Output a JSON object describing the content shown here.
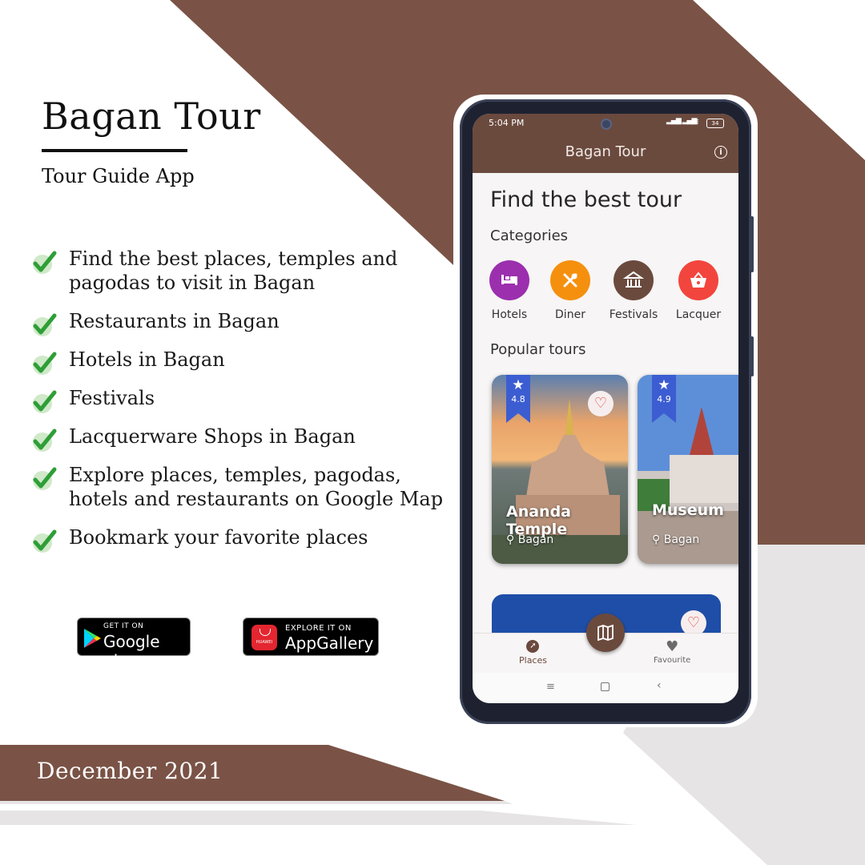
{
  "colors": {
    "brand_brown": "#7a5346",
    "light_gray": "#e6e4e5",
    "app_bar": "#6b4a3e"
  },
  "promo": {
    "title": "Bagan Tour",
    "subtitle": "Tour Guide  App",
    "features": [
      "Find the best places, temples and pagodas to visit in Bagan",
      "Restaurants in Bagan",
      "Hotels in Bagan",
      "Festivals",
      "Lacquerware Shops in Bagan",
      "Explore places, temples, pagodas, hotels and restaurants on Google Map",
      "Bookmark your favorite places"
    ],
    "date": "December 2021"
  },
  "stores": {
    "google": {
      "small": "GET IT ON",
      "big": "Google play"
    },
    "huawei": {
      "small": "EXPLORE IT ON",
      "big": "AppGallery",
      "logo_text": "HUAWEI"
    }
  },
  "phone": {
    "status": {
      "time": "5:04 PM",
      "battery": "34"
    },
    "appbar": {
      "title": "Bagan Tour",
      "info_icon": "info-icon"
    },
    "heading": "Find the best tour",
    "categories_label": "Categories",
    "categories": [
      {
        "label": "Hotels",
        "color": "#9b2fae",
        "icon": "bed-icon"
      },
      {
        "label": "Diner",
        "color": "#f5900f",
        "icon": "utensils-icon"
      },
      {
        "label": "Festivals",
        "color": "#6b4a3e",
        "icon": "temple-icon"
      },
      {
        "label": "Lacquer",
        "color": "#f2453d",
        "icon": "basket-icon"
      }
    ],
    "popular_label": "Popular tours",
    "tours": [
      {
        "name": "Ananda Temple",
        "location": "Bagan",
        "rating": "4.8"
      },
      {
        "name": "Museum",
        "location": "Bagan",
        "rating": "4.9"
      }
    ],
    "bottom_nav": {
      "places": "Places",
      "favourite": "Favourite",
      "map_icon": "map-icon"
    }
  }
}
